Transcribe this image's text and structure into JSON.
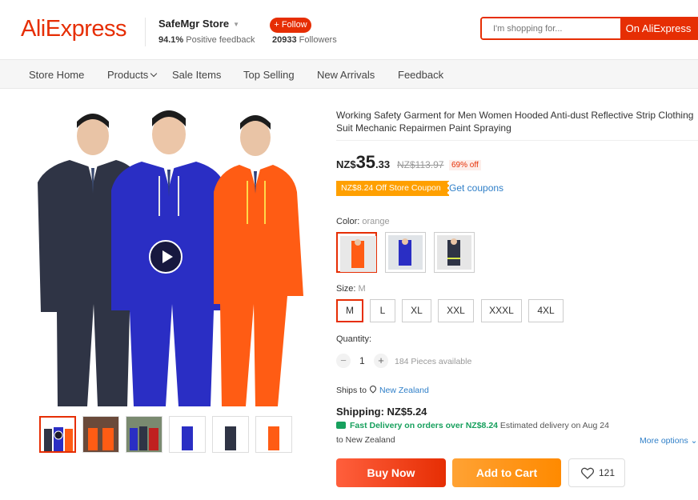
{
  "header": {
    "logo": "AliExpress",
    "store_name": "SafeMgr Store",
    "feedback_pct": "94.1%",
    "feedback_label": "Positive feedback",
    "follow_label": "+ Follow",
    "followers_count": "20933",
    "followers_label": "Followers",
    "search_placeholder": "I'm shopping for...",
    "search_button": "On AliExpress"
  },
  "nav": {
    "items": [
      "Store Home",
      "Products",
      "Sale Items",
      "Top Selling",
      "New Arrivals",
      "Feedback"
    ]
  },
  "product": {
    "title": "Working Safety Garment for Men Women Hooded Anti-dust Reflective Strip Clothing Suit Mechanic Repairmen Paint Spraying",
    "price_currency": "NZ$",
    "price_int": "35",
    "price_dec": ".33",
    "original_price": "NZ$113.97",
    "discount": "69% off",
    "coupon": "NZ$8.24 Off Store Coupon",
    "get_coupons": "Get coupons",
    "color_label": "Color:",
    "color_value": "orange",
    "size_label": "Size:",
    "size_value": "M",
    "sizes": [
      "M",
      "L",
      "XL",
      "XXL",
      "XXXL",
      "4XL"
    ],
    "quantity_label": "Quantity:",
    "quantity_minus": "−",
    "quantity_value": "1",
    "quantity_plus": "+",
    "pieces_available": "184 Pieces available",
    "ships_to_label": "Ships to",
    "ships_to_location": "New Zealand",
    "shipping": "Shipping: NZ$5.24",
    "fast_delivery": "Fast Delivery on orders over NZ$8.24",
    "estimated_delivery": "Estimated delivery on Aug 24",
    "to_location": "to New Zealand",
    "more_options": "More options",
    "buy_now": "Buy Now",
    "add_to_cart": "Add to Cart",
    "wishlist_count": "121"
  },
  "colors": {
    "brand_red": "#e62e04",
    "coupon_orange": "#ffa000",
    "link_blue": "#2f7fc8",
    "fast_green": "#17a05d"
  },
  "icons": {
    "play": "play-icon",
    "location": "location-pin-icon",
    "truck": "truck-icon",
    "heart": "heart-icon",
    "dropdown": "chevron-down-icon"
  }
}
